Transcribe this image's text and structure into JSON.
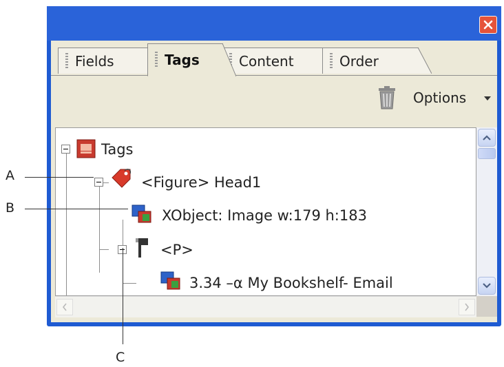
{
  "tabs": [
    {
      "label": "Fields"
    },
    {
      "label": "Tags"
    },
    {
      "label": "Content"
    },
    {
      "label": "Order"
    }
  ],
  "toolbar": {
    "options_label": "Options"
  },
  "tree": {
    "root": {
      "label": "Tags"
    },
    "figure": {
      "label": "<Figure> Head1"
    },
    "xobject": {
      "label": "XObject:  Image  w:179 h:183"
    },
    "paragraph": {
      "label": "<P>"
    },
    "content": {
      "label": "3.34 –α My Bookshelf- Email"
    }
  },
  "callouts": {
    "a": "A",
    "b": "B",
    "c": "C"
  },
  "colors": {
    "titlebar": "#2a63d9",
    "close": "#e5533a",
    "panel": "#ece9d8"
  }
}
